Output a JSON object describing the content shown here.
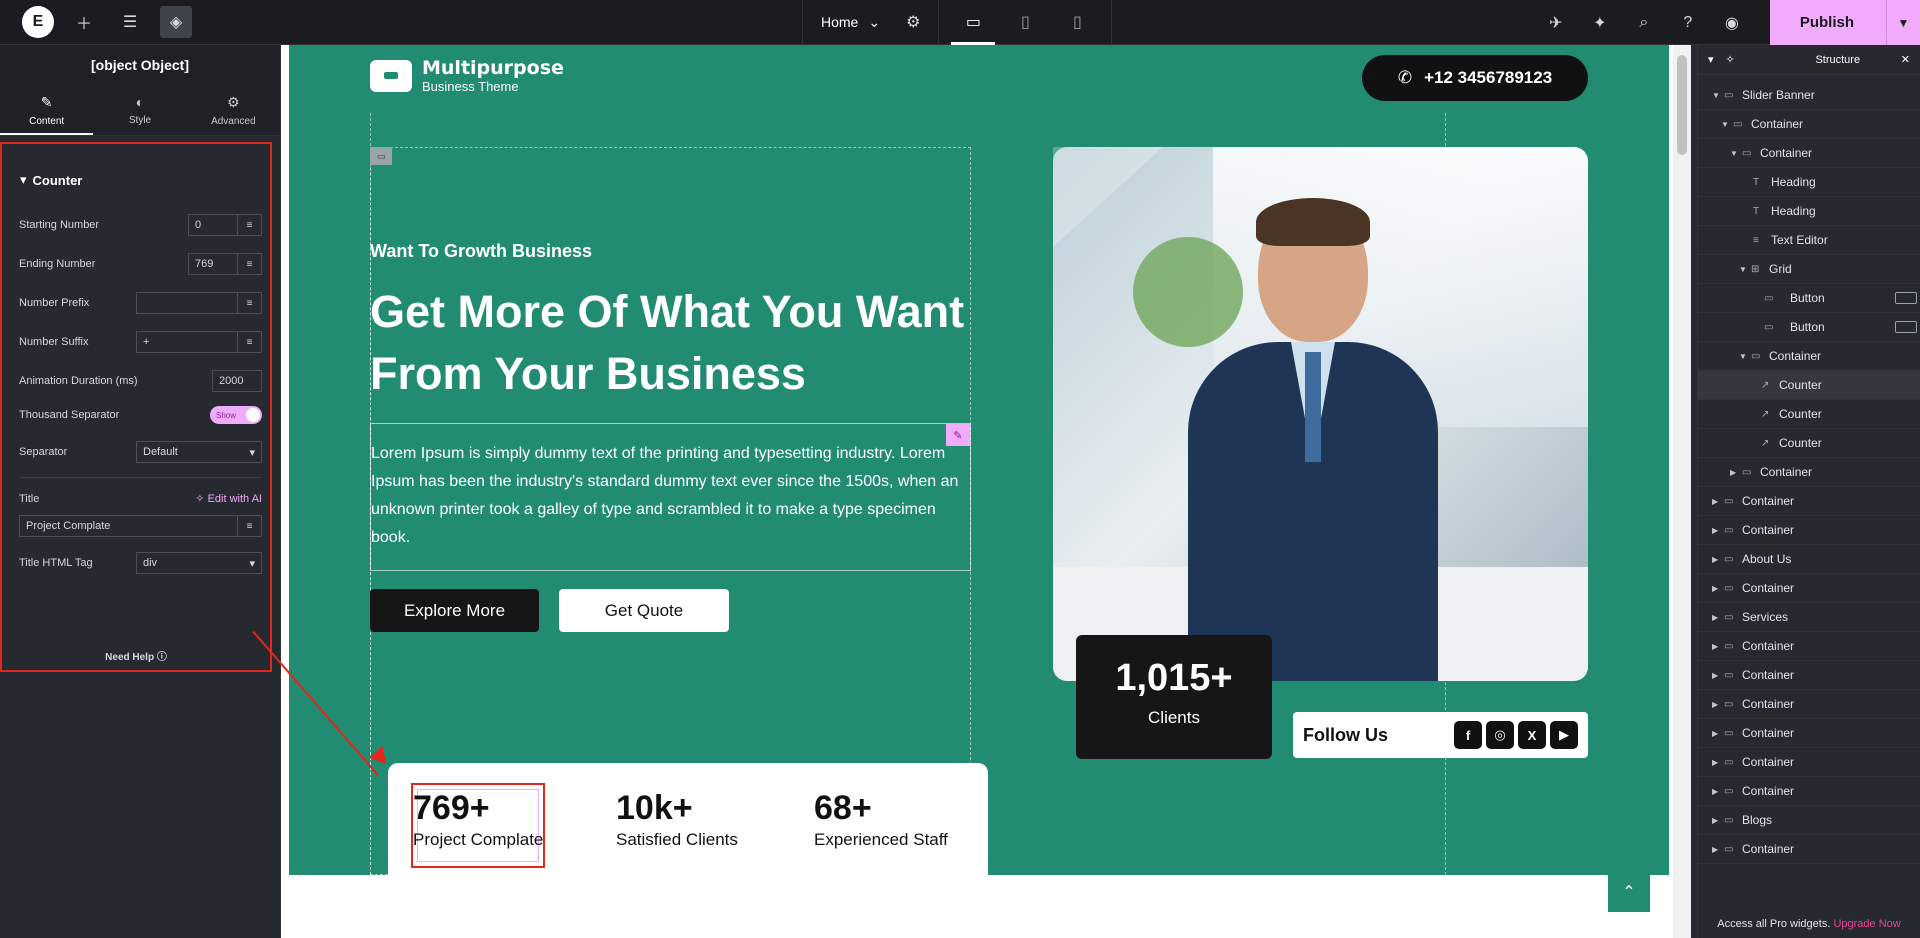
{
  "topbar": {
    "logo_letter": "E",
    "page_name": "Home",
    "publish_label": "Publish"
  },
  "left_panel": {
    "title": {
      "label": "Title",
      "ai_label": "Edit with AI",
      "value": "Project Complate"
    },
    "tabs": [
      {
        "label": "Content",
        "icon": "pencil-icon",
        "active": true
      },
      {
        "label": "Style",
        "icon": "contrast-icon",
        "active": false
      },
      {
        "label": "Advanced",
        "icon": "gear-icon",
        "active": false
      }
    ],
    "section_title": "Counter",
    "starting_number": {
      "label": "Starting Number",
      "value": "0"
    },
    "ending_number": {
      "label": "Ending Number",
      "value": "769"
    },
    "number_prefix": {
      "label": "Number Prefix",
      "value": ""
    },
    "number_suffix": {
      "label": "Number Suffix",
      "value": "+"
    },
    "animation_duration": {
      "label": "Animation Duration (ms)",
      "value": "2000"
    },
    "thousand_separator": {
      "label": "Thousand Separator",
      "value": "Show"
    },
    "separator": {
      "label": "Separator",
      "value": "Default"
    },
    "title_tag": {
      "label": "Title HTML Tag",
      "value": "div"
    },
    "need_help": "Need Help"
  },
  "site": {
    "brand_name": "Multipurpose",
    "brand_sub": "Business Theme",
    "phone": "+12 3456789123",
    "kicker": "Want To Growth Business",
    "headline": "Get More Of What You Want From Your Business",
    "body": "Lorem Ipsum is simply dummy text of the printing and typesetting industry. Lorem Ipsum has been the industry's standard dummy text ever since the 1500s, when an unknown printer took a galley of type and scrambled it to make a type specimen book.",
    "btn_explore": "Explore More",
    "btn_quote": "Get Quote",
    "clients_num": "1,015+",
    "clients_label": "Clients",
    "follow_label": "Follow Us",
    "social": [
      "f",
      "◎",
      "X",
      "▶"
    ],
    "counters": [
      {
        "num": "769+",
        "label": "Project Complate"
      },
      {
        "num": "10k+",
        "label": "Satisfied Clients"
      },
      {
        "num": "68+",
        "label": "Experienced Staff"
      }
    ]
  },
  "structure": {
    "title": "Structure",
    "nodes": [
      {
        "label": "Slider Banner"
      },
      {
        "label": "Container"
      },
      {
        "label": "Container"
      },
      {
        "label": "Heading"
      },
      {
        "label": "Heading"
      },
      {
        "label": "Text Editor"
      },
      {
        "label": "Grid"
      },
      {
        "label": "Button"
      },
      {
        "label": "Button"
      },
      {
        "label": "Container"
      },
      {
        "label": "Counter"
      },
      {
        "label": "Counter"
      },
      {
        "label": "Counter"
      },
      {
        "label": "Container"
      },
      {
        "label": "Container"
      },
      {
        "label": "Container"
      },
      {
        "label": "About Us"
      },
      {
        "label": "Container"
      },
      {
        "label": "Services"
      },
      {
        "label": "Container"
      },
      {
        "label": "Container"
      },
      {
        "label": "Container"
      },
      {
        "label": "Container"
      },
      {
        "label": "Container"
      },
      {
        "label": "Container"
      },
      {
        "label": "Blogs"
      },
      {
        "label": "Container"
      }
    ],
    "footer_text": "Access all Pro widgets.",
    "footer_link": "Upgrade Now"
  }
}
